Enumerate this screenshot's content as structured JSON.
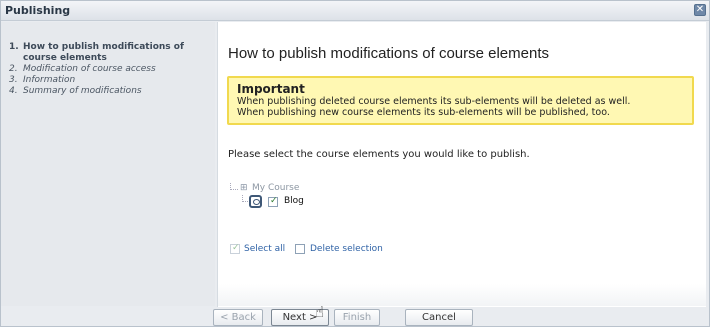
{
  "window": {
    "title": "Publishing",
    "close_icon": "close-icon",
    "close_glyph": "✕"
  },
  "sidebar": {
    "steps": [
      {
        "num": "1.",
        "label": "How to publish modifications of course elements"
      },
      {
        "num": "2.",
        "label": "Modification of course access"
      },
      {
        "num": "3.",
        "label": "Information"
      },
      {
        "num": "4.",
        "label": "Summary of modifications"
      }
    ]
  },
  "main": {
    "heading": "How to publish modifications of course elements",
    "important": {
      "title": "Important",
      "line1": "When publishing deleted course elements its sub-elements will be deleted as well.",
      "line2": "When publishing new course elements its sub-elements will be published, too."
    },
    "instruction": "Please select the course elements you would like to publish.",
    "tree": {
      "root_icon": "course-structure-icon",
      "root_glyph": "⊞",
      "root_label": "My Course",
      "child_icon": "blog-icon",
      "child_label": "Blog",
      "child_checked": true
    },
    "select_all": "Select all",
    "delete_selection": "Delete selection"
  },
  "buttons": {
    "back": "< Back",
    "next": "Next >",
    "finish": "Finish",
    "cancel": "Cancel"
  },
  "cursor_glyph": "☝",
  "colors": {
    "important_bg": "#fff8b3",
    "important_border": "#f1d94e",
    "link": "#2f62a6"
  }
}
